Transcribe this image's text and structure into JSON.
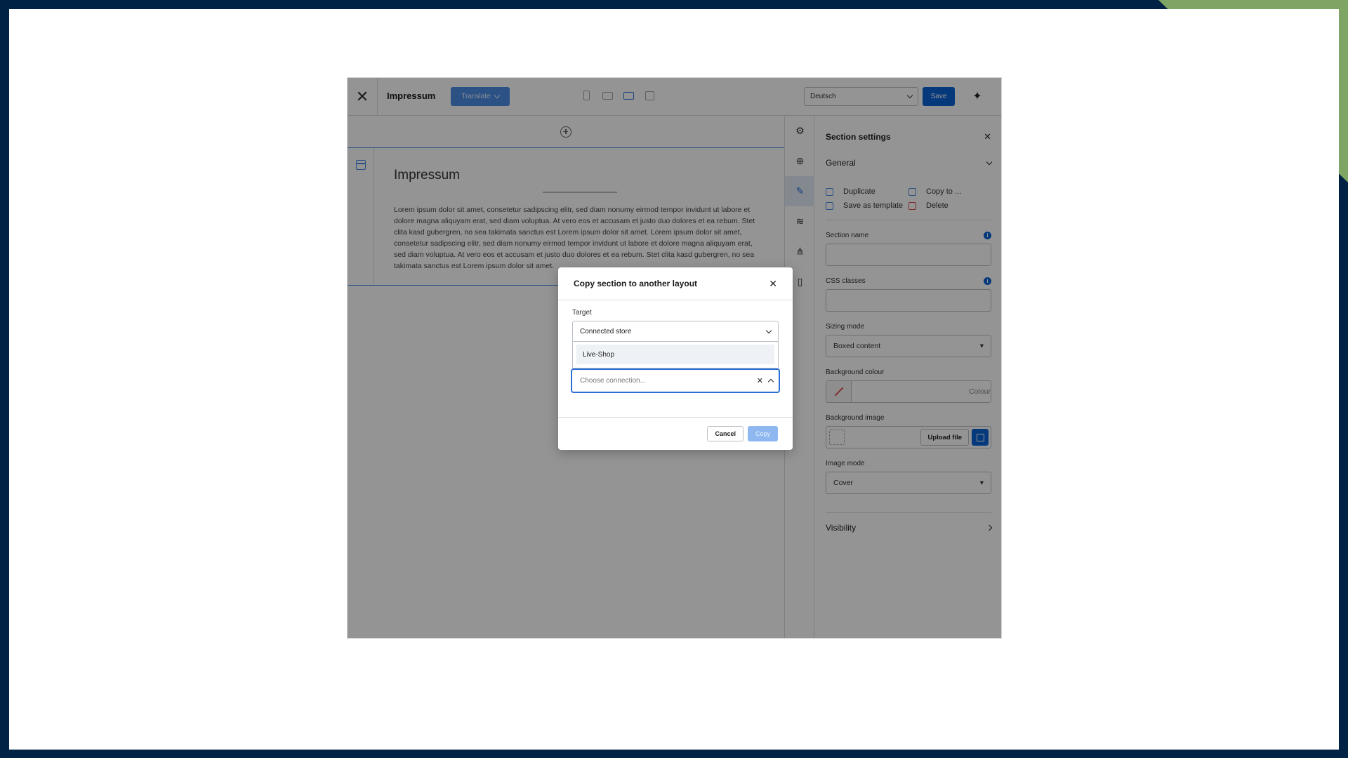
{
  "topbar": {
    "close_icon": "close-icon",
    "title": "Impressum",
    "translate_label": "Translate",
    "devices": [
      "mobile-icon",
      "tablet-icon",
      "desktop-icon",
      "list-icon"
    ],
    "language": "Deutsch",
    "save_label": "Save",
    "ai_icon": "sparkle-icon"
  },
  "canvas": {
    "section_heading": "Impressum",
    "section_text": "Lorem ipsum dolor sit amet, consetetur sadipscing elitr, sed diam nonumy eirmod tempor invidunt ut labore et dolore magna aliquyam erat, sed diam voluptua. At vero eos et accusam et justo duo dolores et ea rebum. Stet clita kasd gubergren, no sea takimata sanctus est Lorem ipsum dolor sit amet. Lorem ipsum dolor sit amet, consetetur sadipscing elitr, sed diam nonumy eirmod tempor invidunt ut labore et dolore magna aliquyam erat, sed diam voluptua. At vero eos et accusam et justo duo dolores et ea rebum. Stet clita kasd gubergren, no sea takimata sanctus est Lorem ipsum dolor sit amet."
  },
  "rail": {
    "items": [
      "gear-icon",
      "add-circle-icon",
      "edit-icon",
      "layers-icon",
      "share-icon",
      "bookmark-icon"
    ]
  },
  "panel": {
    "title": "Section settings",
    "general_label": "General",
    "actions": {
      "duplicate": "Duplicate",
      "copy_to": "Copy to ...",
      "save_as_template": "Save as template",
      "delete": "Delete"
    },
    "section_name_label": "Section name",
    "section_name_value": "",
    "css_classes_label": "CSS classes",
    "css_classes_value": "",
    "sizing_mode_label": "Sizing mode",
    "sizing_mode_value": "Boxed content",
    "background_colour_label": "Background colour",
    "background_colour_placeholder": "Colour",
    "background_image_label": "Background image",
    "upload_label": "Upload file",
    "image_mode_label": "Image mode",
    "image_mode_value": "Cover",
    "visibility_label": "Visibility"
  },
  "modal": {
    "title": "Copy section to another layout",
    "target_label": "Target",
    "target_value": "Connected store",
    "options": [
      "Live-Shop"
    ],
    "connection_placeholder": "Choose connection...",
    "cancel_label": "Cancel",
    "copy_label": "Copy"
  },
  "colors": {
    "background_navy": "#002244",
    "corner_green": "#7fa564",
    "primary_blue": "#0b63d6",
    "focus_blue": "#2b6fd6"
  }
}
